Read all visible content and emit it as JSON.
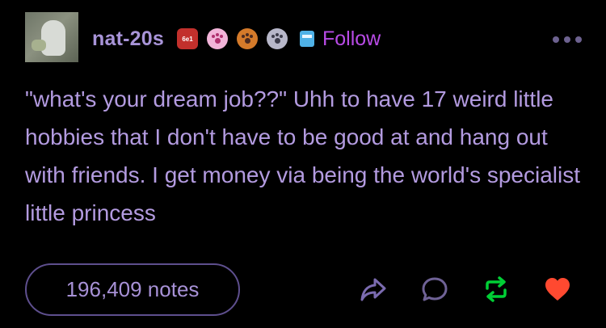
{
  "post": {
    "username": "nat-20s",
    "follow_label": "Follow",
    "badges": [
      {
        "icon": "d20-badge-icon",
        "text": "6e1",
        "color": "#c2302c"
      },
      {
        "icon": "pink-paw-badge-icon",
        "color": "#f2b4d9"
      },
      {
        "icon": "orange-paw-badge-icon",
        "color": "#d47a2a"
      },
      {
        "icon": "gray-paw-badge-icon",
        "color": "#b7b7c9"
      },
      {
        "icon": "robot-badge-icon",
        "color": "#4fb1e6"
      }
    ],
    "body": "\"what's your dream job??\" Uhh to have 17 weird little hobbies that I don't have to be good at and hang out with friends. I get money via being the world's specialist little princess",
    "notes_label": "196,409 notes",
    "actions": {
      "share_icon": "share-icon",
      "reply_icon": "reply-icon",
      "reblog_icon": "reblog-icon",
      "like_icon": "heart-icon"
    }
  },
  "colors": {
    "background": "#000000",
    "text": "#b39be0",
    "follow": "#b84be6",
    "reblog": "#00cf35",
    "like": "#ff4930"
  }
}
